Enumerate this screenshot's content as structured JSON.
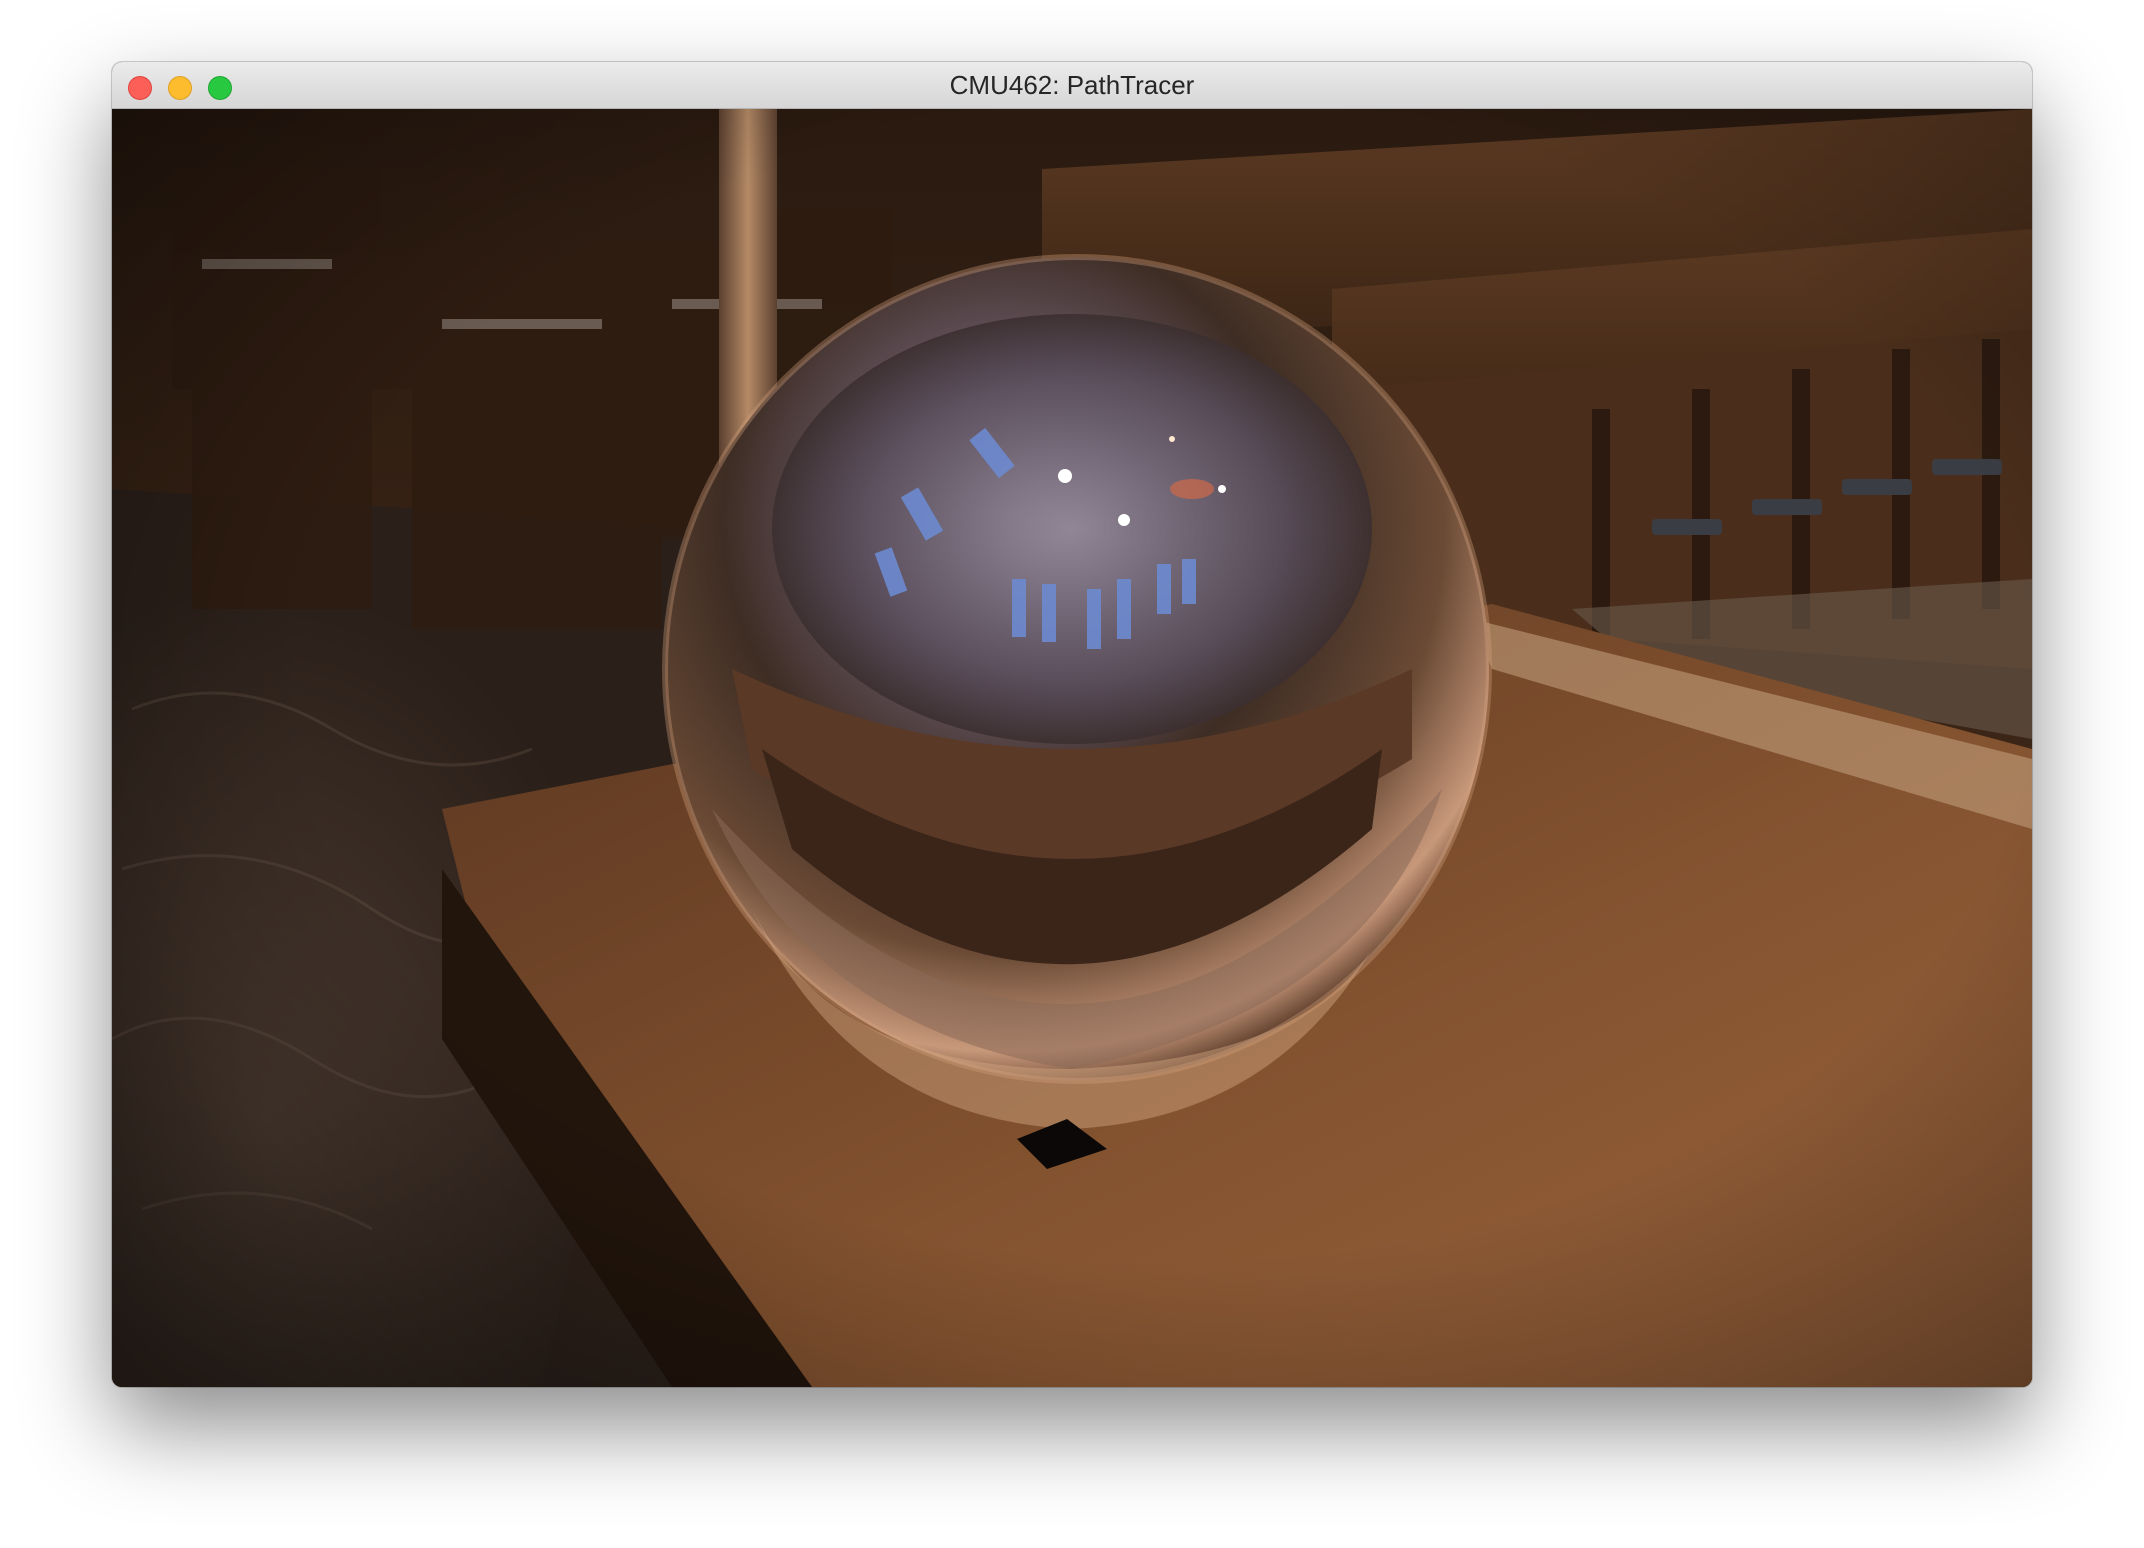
{
  "window": {
    "title": "CMU462: PathTracer",
    "controls": [
      "close-icon",
      "minimize-icon",
      "maximize-icon"
    ]
  },
  "viewport": {
    "content": "rendered-scene"
  },
  "colors": {
    "close": "#fc5f57",
    "minimize": "#fdbc2e",
    "maximize": "#28c840",
    "titlebar": "#e4e4e4",
    "wood": "#6b4228",
    "floor": "#3d2e24"
  }
}
